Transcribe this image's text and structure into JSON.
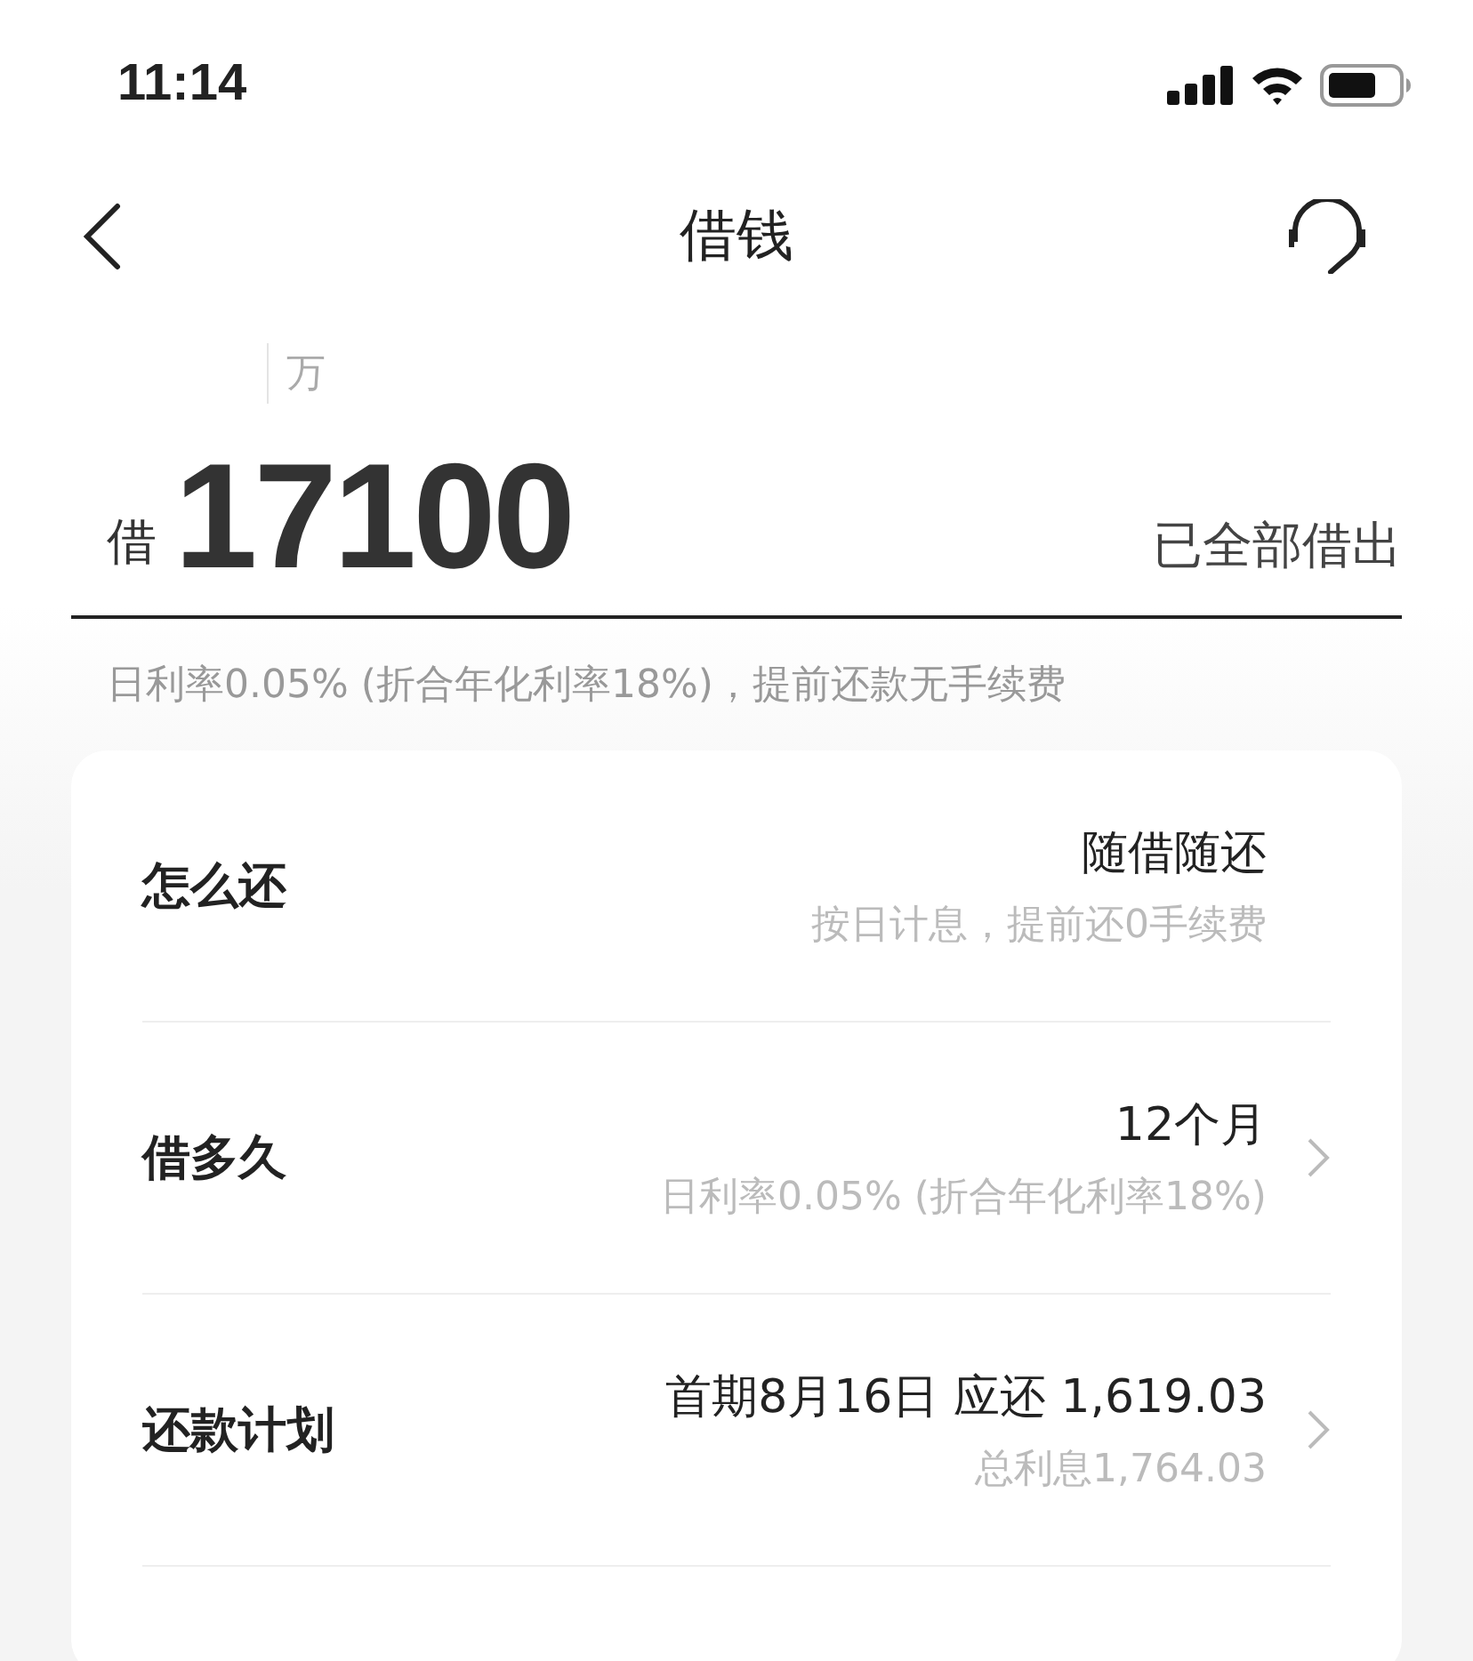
{
  "status_bar": {
    "time": "11:14"
  },
  "nav": {
    "title": "借钱"
  },
  "amount": {
    "unit_hint": "万",
    "prefix": "借",
    "value": "17100",
    "action": "已全部借出"
  },
  "rate_note": "日利率0.05% (折合年化利率18%)，提前还款无手续费",
  "rows": [
    {
      "label": "怎么还",
      "value": "随借随还",
      "detail": "按日计息，提前还0手续费",
      "chevron": false
    },
    {
      "label": "借多久",
      "value": "12个月",
      "detail": "日利率0.05% (折合年化利率18%)",
      "chevron": true
    },
    {
      "label": "还款计划",
      "value": "首期8月16日 应还 1,619.03",
      "detail": "总利息1,764.03",
      "chevron": true
    }
  ]
}
